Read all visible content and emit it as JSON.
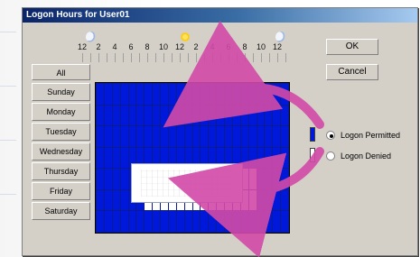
{
  "dialog": {
    "title": "Logon Hours for User01",
    "buttons": {
      "ok": "OK",
      "cancel": "Cancel"
    },
    "ruler": {
      "labels": [
        "12",
        "2",
        "4",
        "6",
        "8",
        "10",
        "12",
        "2",
        "4",
        "6",
        "8",
        "10",
        "12"
      ]
    },
    "days": {
      "all": "All",
      "items": [
        "Sunday",
        "Monday",
        "Tuesday",
        "Wednesday",
        "Thursday",
        "Friday",
        "Saturday"
      ]
    },
    "options": {
      "permitted": "Logon Permitted",
      "denied": "Logon Denied",
      "selected": "permitted"
    },
    "colors": {
      "permitted": "#0018d9",
      "denied": "#ffffff",
      "arrow": "#d24aa8"
    }
  }
}
